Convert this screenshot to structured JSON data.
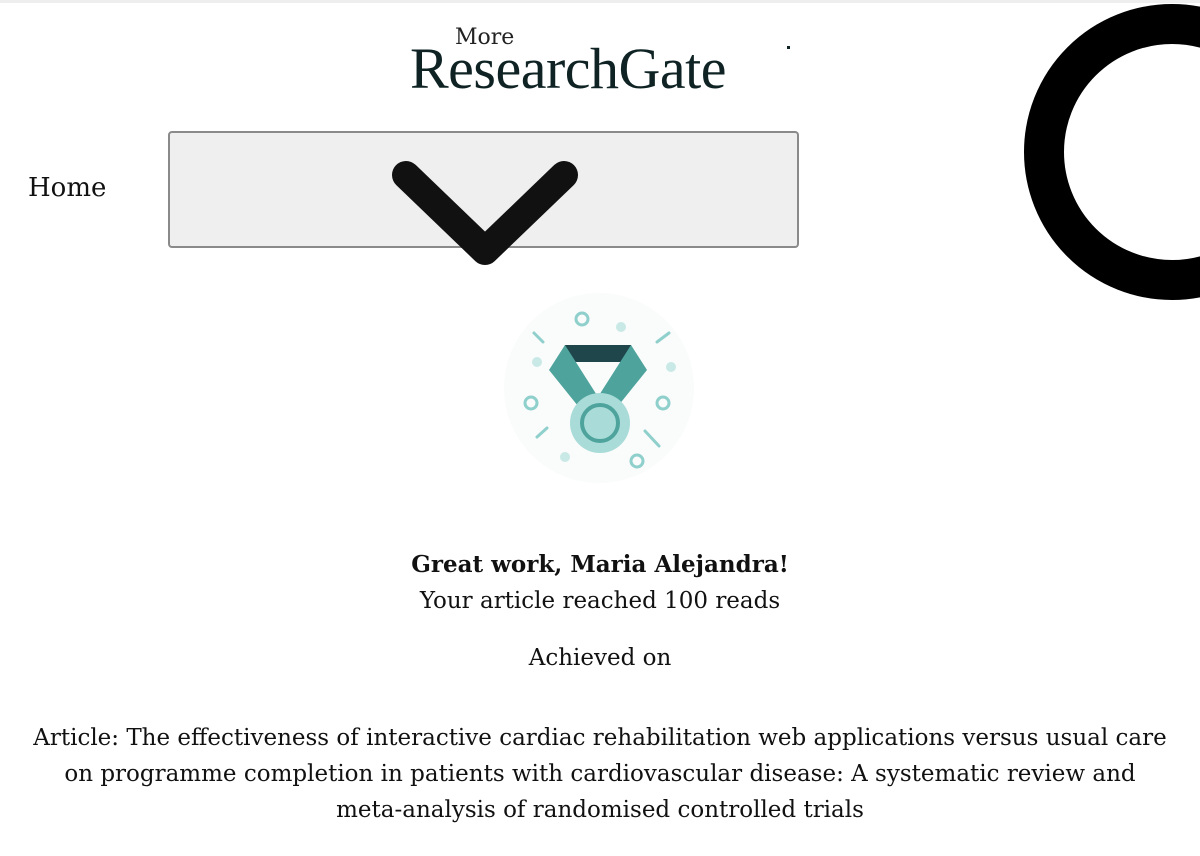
{
  "header": {
    "more_label": "More",
    "logo_text": "ResearchGate",
    "home_label": "Home",
    "menu_icon": "chevron-down-icon",
    "loading_icon": "loading-ring-icon"
  },
  "achievement": {
    "badge_icon": "medal-icon",
    "colors": {
      "ribbon_dark": "#1e464b",
      "ribbon_teal": "#4ea49d",
      "medal_light": "#a9dcd8",
      "sparkle": "#8fd0cc"
    },
    "title": "Great work, Maria Alejandra!",
    "subtitle": "Your article reached 100 reads",
    "achieved_label": "Achieved on",
    "article_text": "Article: The effectiveness of interactive cardiac rehabilitation web applications versus usual care on programme completion in patients with cardiovascular disease: A systematic review and meta-analysis of randomised controlled trials"
  }
}
